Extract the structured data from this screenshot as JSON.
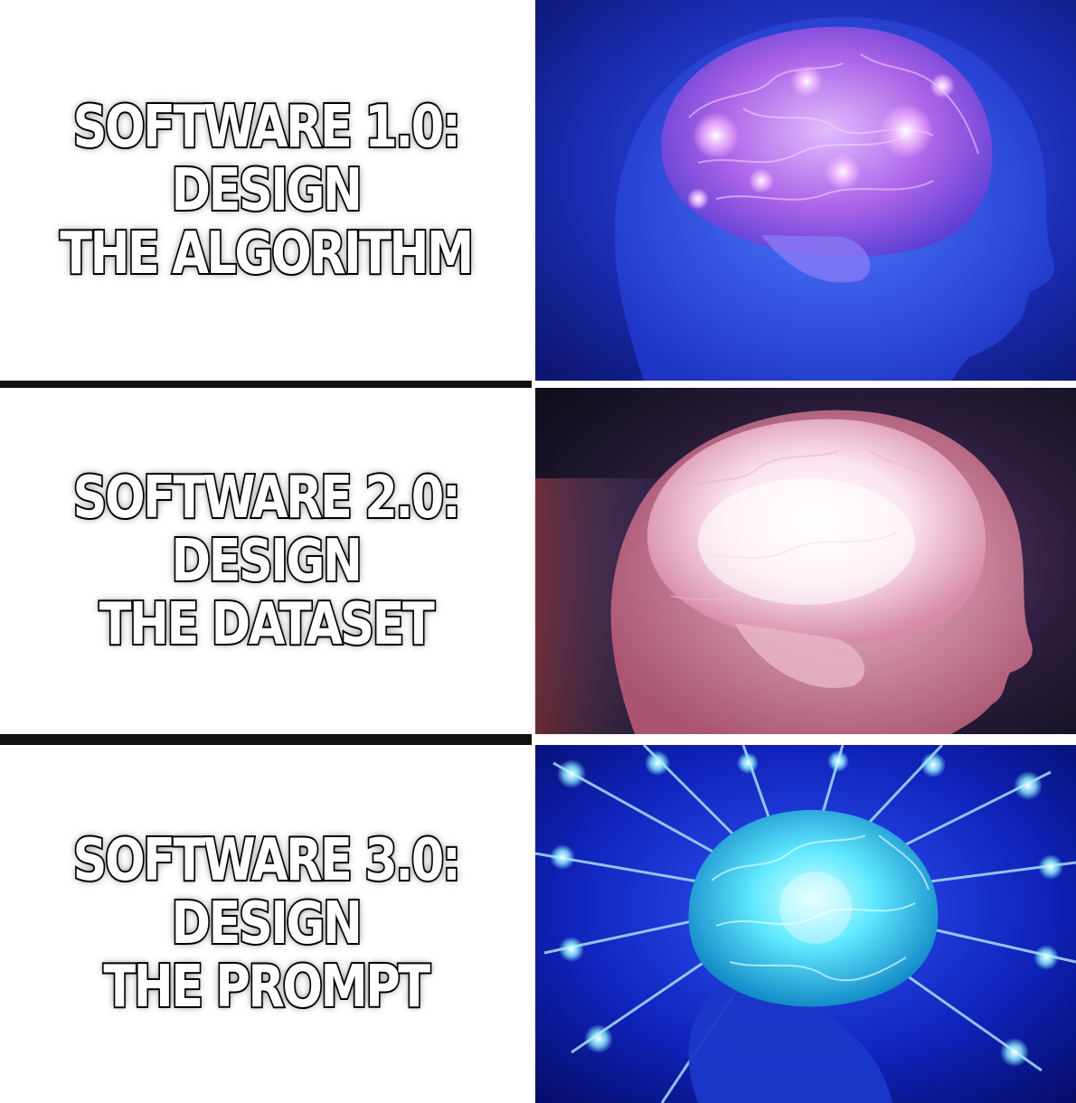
{
  "panels": [
    {
      "line1": "SOFTWARE 1.0:",
      "line2": "DESIGN",
      "line3": "THE ALGORITHM",
      "image": "glowing-brain-blue-purple",
      "colors": {
        "bg": "#1b2fb8",
        "glow": "#e9a6ff",
        "head": "#2d5ef0"
      }
    },
    {
      "line1": "SOFTWARE 2.0:",
      "line2": "DESIGN",
      "line3": "THE DATASET",
      "image": "glowing-brain-white-pink",
      "colors": {
        "bg": "#1a1a2e",
        "glow": "#ffffff",
        "head": "#e7a4b4"
      }
    },
    {
      "line1": "SOFTWARE 3.0:",
      "line2": "DESIGN",
      "line3": "THE PROMPT",
      "image": "radiating-brain-cyan",
      "colors": {
        "bg": "#0b1aa8",
        "glow": "#6ff0ff",
        "head": "#1f3fd0"
      }
    }
  ]
}
